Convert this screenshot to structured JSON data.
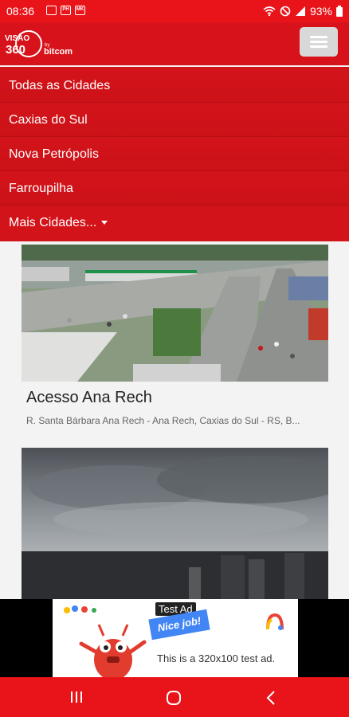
{
  "status": {
    "time": "08:36",
    "battery": "93%"
  },
  "brand": {
    "main": "VISÃO",
    "number": "360",
    "by": "by",
    "company": "bitcom"
  },
  "menu": {
    "items": [
      "Todas as Cidades",
      "Caxias do Sul",
      "Nova Petrópolis",
      "Farroupilha",
      "Mais Cidades..."
    ]
  },
  "cameras": [
    {
      "title": "Acesso Ana Rech",
      "address": "R. Santa Bárbara Ana Rech - Ana Rech, Caxias do Sul - RS, B..."
    },
    {
      "title": "",
      "address": ""
    }
  ],
  "ad": {
    "label": "Test Ad",
    "badge": "Nice job!",
    "description": "This is a 320x100 test ad."
  },
  "colors": {
    "primary": "#d8121a",
    "menu": "#d3131a",
    "statusbar": "#e8141a"
  }
}
